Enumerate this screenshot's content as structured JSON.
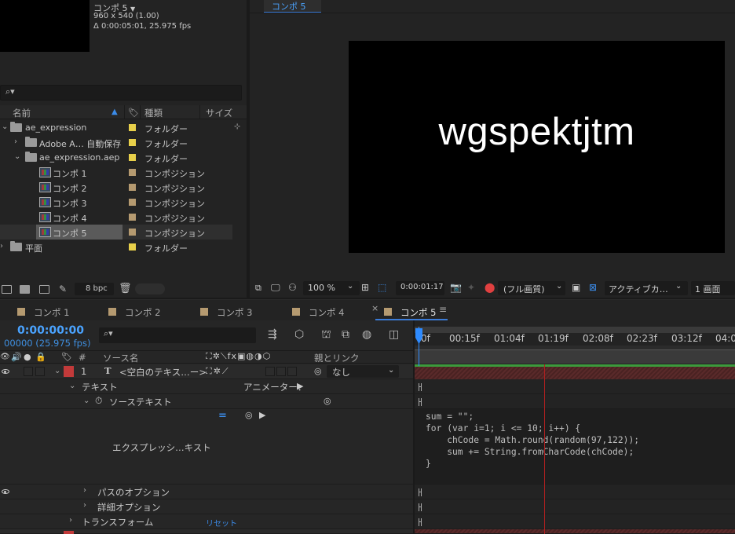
{
  "project": {
    "comp_name": "コンポ 5",
    "comp_dims": "960 x 540 (1.00)",
    "comp_duration": "Δ 0:00:05:01, 25.975 fps",
    "search_icon": "search-icon",
    "columns": {
      "name": "名前",
      "type": "種類",
      "size": "サイズ"
    },
    "items": [
      {
        "name": "ae_expression",
        "type": "フォルダー",
        "kind": "folder",
        "color": "#e8d04a"
      },
      {
        "name": "Adobe A… 自動保存",
        "type": "フォルダー",
        "kind": "folder",
        "color": "#e8d04a"
      },
      {
        "name": "ae_expression.aep",
        "type": "フォルダー",
        "kind": "folder",
        "color": "#e8d04a"
      },
      {
        "name": "コンポ 1",
        "type": "コンポジション",
        "kind": "comp",
        "color": "#b59a70"
      },
      {
        "name": "コンポ 2",
        "type": "コンポジション",
        "kind": "comp",
        "color": "#b59a70"
      },
      {
        "name": "コンポ 3",
        "type": "コンポジション",
        "kind": "comp",
        "color": "#b59a70"
      },
      {
        "name": "コンポ 4",
        "type": "コンポジション",
        "kind": "comp",
        "color": "#b59a70"
      },
      {
        "name": "コンポ 5",
        "type": "コンポジション",
        "kind": "comp",
        "color": "#b59a70"
      },
      {
        "name": "平面",
        "type": "フォルダー",
        "kind": "folder",
        "color": "#e8d04a"
      }
    ],
    "bpc": "8 bpc"
  },
  "viewer": {
    "tab": "コンポ 5",
    "canvas_text": "wgspektjtm",
    "zoom": "100 %",
    "timecode": "0:00:01:17",
    "quality": "(フル画質)",
    "camera": "アクティブカ…",
    "views": "1 画面"
  },
  "timeline": {
    "tabs": [
      "コンポ 1",
      "コンポ 2",
      "コンポ 3",
      "コンポ 4",
      "コンポ 5"
    ],
    "active_tab": "コンポ 5",
    "close_glyph": "×",
    "menu_glyph": "≡",
    "current_time": "0:00:00:00",
    "frames": "00000 (25.975 fps)",
    "columns": {
      "hash": "#",
      "source_name": "ソース名",
      "parent": "親とリンク"
    },
    "layer": {
      "index": "1",
      "type_glyph": "T",
      "name": "<空白のテキス…ー>",
      "parent": "なし"
    },
    "props": {
      "text": "テキスト",
      "animator": "アニメーター：",
      "source_text": "ソーステキスト",
      "expression_label": "エクスプレッシ…キスト",
      "path_options": "パスのオプション",
      "more_options": "詳細オプション",
      "transform": "トランスフォーム",
      "reset": "リセット"
    },
    "ruler": [
      "0f",
      "00:15f",
      "01:04f",
      "01:19f",
      "02:08f",
      "02:23f",
      "03:12f",
      "04:0"
    ],
    "expression_code": "sum = \"\";\nfor (var i=1; i <= 10; i++) {\n    chCode = Math.round(random(97,122));\n    sum += String.fromCharCode(chCode);\n}",
    "colors": {
      "accent": "#2e8bff",
      "layer_label": "#c23a3a",
      "playhead_line": "#b02020",
      "work_area": "#3c9a3c"
    }
  }
}
